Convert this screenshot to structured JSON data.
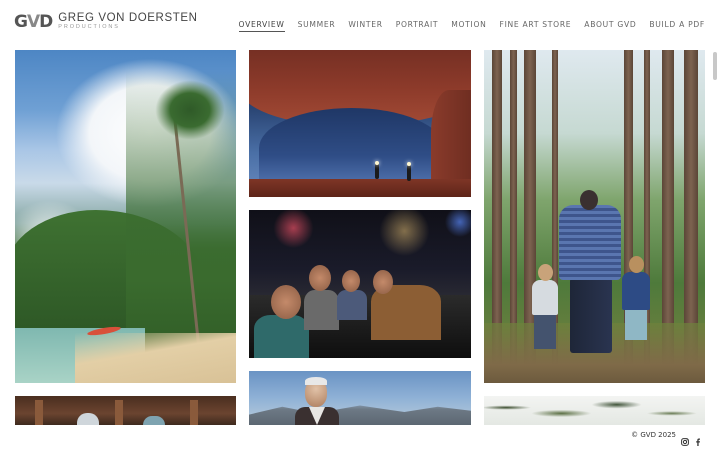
{
  "brand": {
    "mark": "GVD",
    "name": "GREG VON DOERSTEN",
    "subtitle": "PRODUCTIONS"
  },
  "nav": {
    "items": [
      {
        "label": "OVERVIEW",
        "active": true
      },
      {
        "label": "SUMMER",
        "active": false
      },
      {
        "label": "WINTER",
        "active": false
      },
      {
        "label": "PORTRAIT",
        "active": false
      },
      {
        "label": "MOTION",
        "active": false
      },
      {
        "label": "FINE ART STORE",
        "active": false
      },
      {
        "label": "ABOUT GVD",
        "active": false
      },
      {
        "label": "BUILD A PDF",
        "active": false
      }
    ]
  },
  "gallery": {
    "photos": [
      {
        "subject": "tropical beach with palm trees"
      },
      {
        "subject": "two hikers with headlamps under a red rock arch at night"
      },
      {
        "subject": "friends laughing in a car at night"
      },
      {
        "subject": "father and two kids walking in a forest"
      },
      {
        "subject": "elderly man portrait with mountains"
      },
      {
        "subject": "wooden interior"
      },
      {
        "subject": "leaves"
      }
    ]
  },
  "footer": {
    "copyright": "© GVD 2025",
    "icons": [
      "instagram-icon",
      "facebook-icon"
    ]
  }
}
